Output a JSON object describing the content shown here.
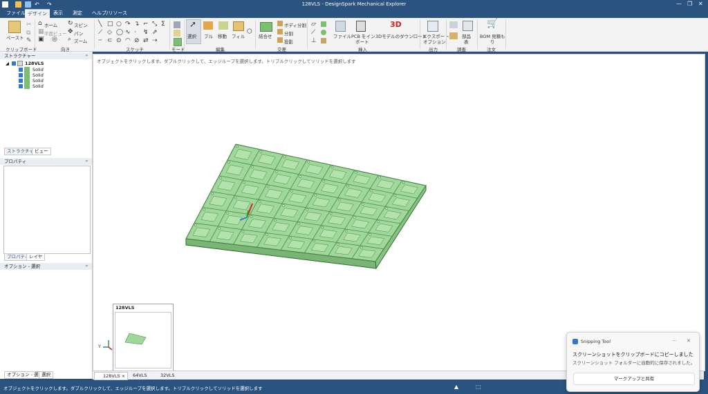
{
  "window": {
    "title": "128VLS - DesignSpark Mechanical Explorer",
    "minimize": "—",
    "restore": "❐",
    "close": "✕"
  },
  "menu_tabs": [
    "ファイル",
    "デザイン",
    "表示",
    "測定",
    "ヘルプ/リソース"
  ],
  "ribbon": {
    "clipboard": {
      "paste": "ペースト",
      "group": "クリップボード"
    },
    "orient": {
      "home": "ホーム",
      "plan_view": "平面ビュー",
      "spin": "スピン",
      "pan": "パン",
      "zoom": "ズーム",
      "group": "向き"
    },
    "sketch": {
      "group": "スケッチ"
    },
    "mode": {
      "group": "モード"
    },
    "edit": {
      "select": "選択",
      "pull": "プル",
      "move": "移動",
      "fill": "フィル",
      "group": "編集"
    },
    "intersect": {
      "combine": "結合せ",
      "body_split": "ボディ分割",
      "split": "分割",
      "project": "投影",
      "group": "交差"
    },
    "insert": {
      "file": "ファイル",
      "pcb_line1": "PCB をイン",
      "pcb_line2": "ポート",
      "model3d_badge": "3D",
      "download3d": "3Dモデルのダウンロード",
      "group": "挿入"
    },
    "output": {
      "export_line1": "エクスポート",
      "export_line2": "オプション",
      "group": "出力"
    },
    "investigate": {
      "parts_line1": "部品",
      "parts_line2": "表",
      "group": "調査"
    },
    "order": {
      "bom_line1": "BOM 見積も",
      "bom_line2": "り",
      "group": "注文"
    }
  },
  "structure_panel": {
    "header": "ストラクチャー",
    "pin": "ᵖ",
    "root": "128VLS",
    "children": [
      "Solid",
      "Solid",
      "Solid",
      "Solid"
    ],
    "tabs": [
      "ストラクチャー",
      "ビュー"
    ]
  },
  "properties_panel": {
    "header": "プロパティ",
    "pin": "ᵖ",
    "tabs": [
      "プロパティ",
      "レイヤ"
    ]
  },
  "options_panel": {
    "header": "オプション - 選択",
    "pin": "ᵖ",
    "tabs": [
      "オプション - 選択",
      "選択"
    ]
  },
  "viewport": {
    "hint": "オブジェクトをクリックします。ダブルクリックして、エッジループを選択します。トリプルクリックしてソリッドを選択します",
    "thumbnail_title": "128VLS",
    "triad_y": "Y"
  },
  "document_tabs": [
    "128VLS",
    "64VLS",
    "32VLS"
  ],
  "document_tab_close": "×",
  "status": {
    "text": "オブジェクトをクリックします。ダブルクリックして、エッジループを選択します。トリプルクリックしてソリッドを選択します"
  },
  "toast": {
    "app": "Snipping Tool",
    "more": "···",
    "close": "✕",
    "line1": "スクリーンショットをクリップボードにコピーしました",
    "line2": "スクリーンショット フォルダーに自動的に保存されました。",
    "button": "マークアップと共有"
  },
  "colors": {
    "titlebar": "#2b5380",
    "ribbon": "#f3f3f3",
    "model_fill": "#9fd89a",
    "model_edge": "#2f6b2f",
    "accent_red": "#d32020"
  }
}
